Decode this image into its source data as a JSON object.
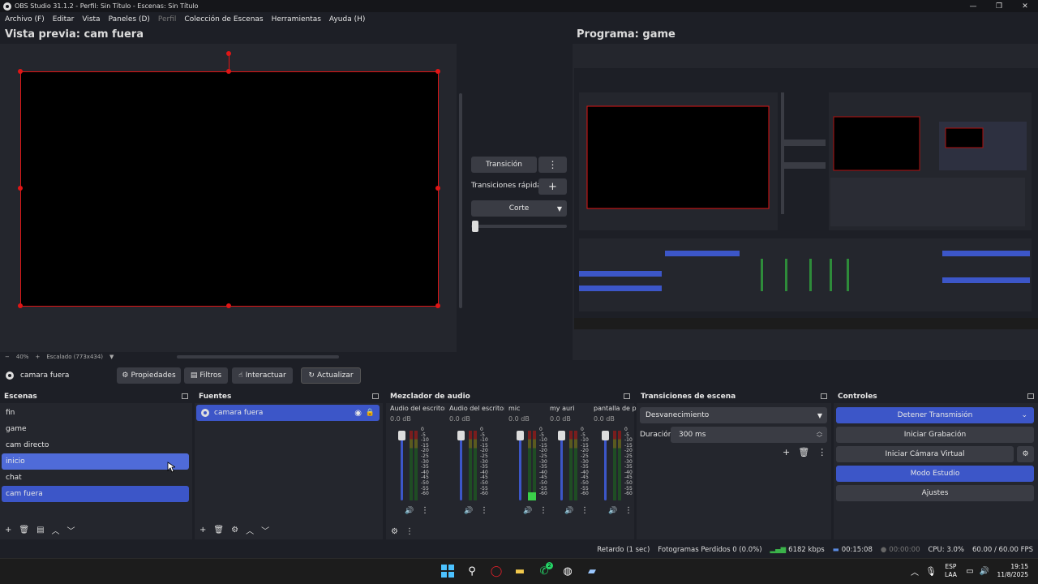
{
  "window": {
    "title": "OBS Studio 31.1.2 - Perfil: Sin Título - Escenas: Sin Título",
    "controls": [
      "—",
      "❐",
      "✕"
    ]
  },
  "menu": [
    "Archivo (F)",
    "Editar",
    "Vista",
    "Paneles (D)",
    "Perfil",
    "Colección de Escenas",
    "Herramientas",
    "Ayuda (H)"
  ],
  "preview": {
    "title": "Vista previa: cam fuera",
    "zoom": "40%",
    "scaling": "Escalado (773x434)"
  },
  "program": {
    "title": "Programa: game"
  },
  "transition": {
    "button": "Transición",
    "quick": "Transiciones rápidas",
    "type": "Corte",
    "menu_icon": "⋮",
    "add_icon": "+"
  },
  "source_toolbar": {
    "source": "camara fuera",
    "properties": "Propiedades",
    "filters": "Filtros",
    "interact": "Interactuar",
    "refresh": "Actualizar"
  },
  "scenes": {
    "title": "Escenas",
    "items": [
      "fin",
      "game",
      "cam directo",
      "inicio",
      "chat",
      "cam fuera"
    ]
  },
  "sources": {
    "title": "Fuentes",
    "items": [
      "camara fuera"
    ]
  },
  "mixer": {
    "title": "Mezclador de audio",
    "channels": [
      {
        "name": "Audio del escritorio",
        "db": "0.0 dB",
        "level": 0.0
      },
      {
        "name": "Audio del escritorio",
        "db": "0.0 dB",
        "level": 0.0
      },
      {
        "name": "mic",
        "db": "0.0 dB",
        "level": 0.12
      },
      {
        "name": "my auri",
        "db": "0.0 dB",
        "level": 0.0
      },
      {
        "name": "pantalla de pc",
        "db": "0.0 dB",
        "level": 0.0
      }
    ],
    "scale": [
      "0",
      "-5",
      "-10",
      "-15",
      "-20",
      "-25",
      "-30",
      "-35",
      "-40",
      "-45",
      "-50",
      "-55",
      "-60"
    ]
  },
  "scene_transitions": {
    "title": "Transiciones de escena",
    "type": "Desvanecimiento",
    "duration_label": "Duración",
    "duration": "300 ms"
  },
  "controls": {
    "title": "Controles",
    "stop_stream": "Detener Transmisión",
    "start_rec": "Iniciar Grabación",
    "virtual_cam": "Iniciar Cámara Virtual",
    "studio": "Modo Estudio",
    "settings": "Ajustes"
  },
  "status": {
    "delay": "Retardo (1 sec)",
    "dropped": "Fotogramas Perdidos 0 (0.0%)",
    "kbps": "6182 kbps",
    "stream_time": "00:15:08",
    "rec_time": "00:00:00",
    "cpu": "CPU: 3.0%",
    "fps": "60.00 / 60.00 FPS"
  },
  "taskbar": {
    "lang1": "ESP",
    "lang2": "LAA",
    "time": "19:15",
    "date": "11/8/2025",
    "whatsapp_badge": "2"
  },
  "colors": {
    "accent": "#3c56c8",
    "selection_red": "#e01515",
    "panel": "#24262d"
  }
}
